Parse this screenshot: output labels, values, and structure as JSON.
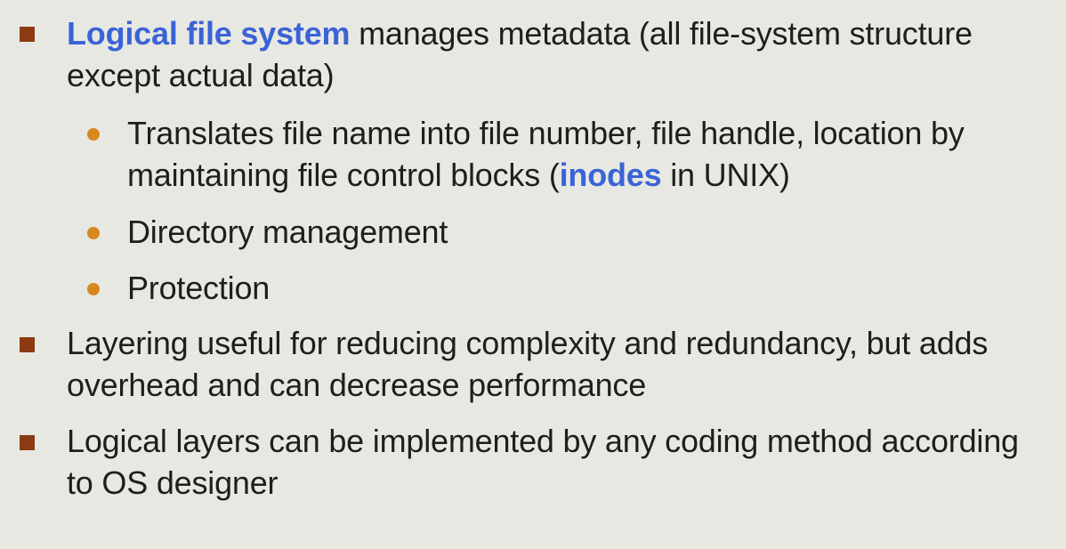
{
  "slide": {
    "bullets": [
      {
        "highlight": "Logical file system",
        "text_after": " manages metadata (all file-system structure except actual data)",
        "sub_bullets": [
          {
            "text_before": "Translates file name into file number, file handle, location by maintaining file control blocks (",
            "highlight": "inodes",
            "text_after": " in UNIX)"
          },
          {
            "text": "Directory management"
          },
          {
            "text": "Protection"
          }
        ]
      },
      {
        "text": "Layering useful for reducing complexity and redundancy, but adds overhead and can decrease performance"
      },
      {
        "text": "Logical layers can be implemented by any coding method according to OS designer"
      }
    ]
  },
  "colors": {
    "background": "#e8e8e3",
    "text": "#1e1e1e",
    "highlight": "#3a63d6",
    "square_bullet": "#8a3b12",
    "dot_bullet": "#d6881f"
  }
}
